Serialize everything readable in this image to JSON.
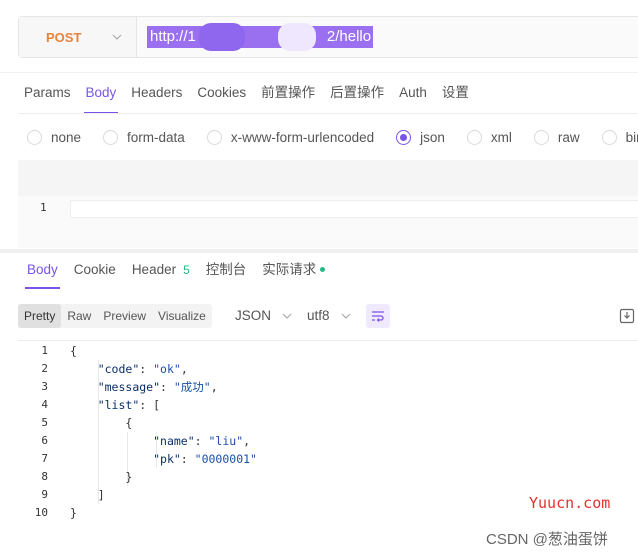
{
  "request": {
    "method": "POST",
    "url_start": "http://1",
    "url_end": "2/hello"
  },
  "request_tabs": [
    {
      "label": "Params"
    },
    {
      "label": "Body"
    },
    {
      "label": "Headers"
    },
    {
      "label": "Cookies"
    },
    {
      "label": "前置操作"
    },
    {
      "label": "后置操作"
    },
    {
      "label": "Auth"
    },
    {
      "label": "设置"
    }
  ],
  "body_types": [
    {
      "label": "none"
    },
    {
      "label": "form-data"
    },
    {
      "label": "x-www-form-urlencoded"
    },
    {
      "label": "json"
    },
    {
      "label": "xml"
    },
    {
      "label": "raw"
    },
    {
      "label": "binar"
    }
  ],
  "body_editor": {
    "line_number": "1"
  },
  "response_tabs": [
    {
      "label": "Body"
    },
    {
      "label": "Cookie"
    },
    {
      "label": "Header",
      "count": "5"
    },
    {
      "label": "控制台"
    },
    {
      "label": "实际请求"
    }
  ],
  "view_modes": [
    {
      "label": "Pretty"
    },
    {
      "label": "Raw"
    },
    {
      "label": "Preview"
    },
    {
      "label": "Visualize"
    }
  ],
  "format_select": "JSON",
  "encoding_select": "utf8",
  "response_code": [
    {
      "n": "1",
      "p1": "{"
    },
    {
      "n": "2",
      "p1": "    ",
      "key": "\"code\"",
      "p2": ": ",
      "val": "\"ok\"",
      "p3": ","
    },
    {
      "n": "3",
      "p1": "    ",
      "key": "\"message\"",
      "p2": ": ",
      "val": "\"成功\"",
      "p3": ","
    },
    {
      "n": "4",
      "p1": "    ",
      "key": "\"list\"",
      "p2": ": ["
    },
    {
      "n": "5",
      "p1": "        {"
    },
    {
      "n": "6",
      "p1": "            ",
      "key": "\"name\"",
      "p2": ": ",
      "val": "\"liu\"",
      "p3": ","
    },
    {
      "n": "7",
      "p1": "            ",
      "key": "\"pk\"",
      "p2": ": ",
      "val": "\"0000001\""
    },
    {
      "n": "8",
      "p1": "        }"
    },
    {
      "n": "9",
      "p1": "    ]"
    },
    {
      "n": "10",
      "p1": "}"
    }
  ],
  "watermarks": {
    "site": "Yuucn.com",
    "author": "CSDN @葱油蛋饼"
  },
  "colors": {
    "accent": "#7a54e8",
    "method": "#e8833a",
    "count": "#27b88a",
    "watermark_red": "#e4302b"
  }
}
